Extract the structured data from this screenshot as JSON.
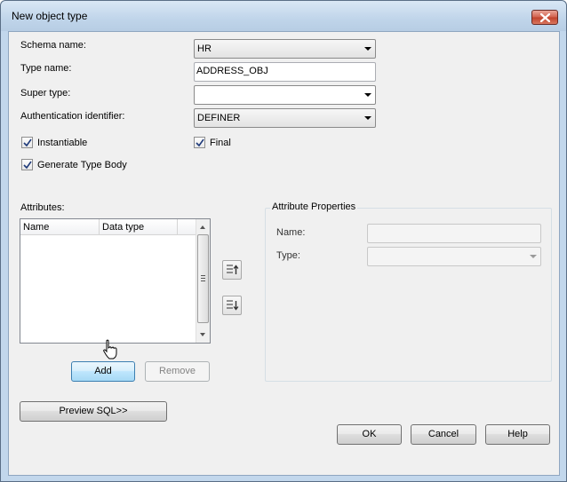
{
  "window": {
    "title": "New object type",
    "close_icon": "close-icon"
  },
  "form": {
    "schema_name": {
      "label": "Schema name:",
      "value": "HR"
    },
    "type_name": {
      "label": "Type name:",
      "value": "ADDRESS_OBJ"
    },
    "super_type": {
      "label": "Super type:",
      "value": ""
    },
    "authentication_identifier": {
      "label": "Authentication identifier:",
      "value": "DEFINER"
    },
    "instantiable": {
      "label": "Instantiable",
      "checked": true
    },
    "final": {
      "label": "Final",
      "checked": true
    },
    "generate_type_body": {
      "label": "Generate Type Body",
      "checked": true
    }
  },
  "attributes": {
    "label": "Attributes:",
    "columns": [
      "Name",
      "Data type"
    ],
    "rows": [],
    "move_up_icon": "move-up-icon",
    "move_down_icon": "move-down-icon",
    "add_label": "Add",
    "remove_label": "Remove"
  },
  "attribute_properties": {
    "title": "Attribute Properties",
    "name_label": "Name:",
    "name_value": "",
    "type_label": "Type:",
    "type_value": ""
  },
  "footer": {
    "preview_sql_label": "Preview SQL>>",
    "ok_label": "OK",
    "cancel_label": "Cancel",
    "help_label": "Help"
  },
  "colors": {
    "titlebar": "#c2d7ec",
    "dialog_bg": "#f0f0f0",
    "focus_button": "#bee6fd"
  }
}
